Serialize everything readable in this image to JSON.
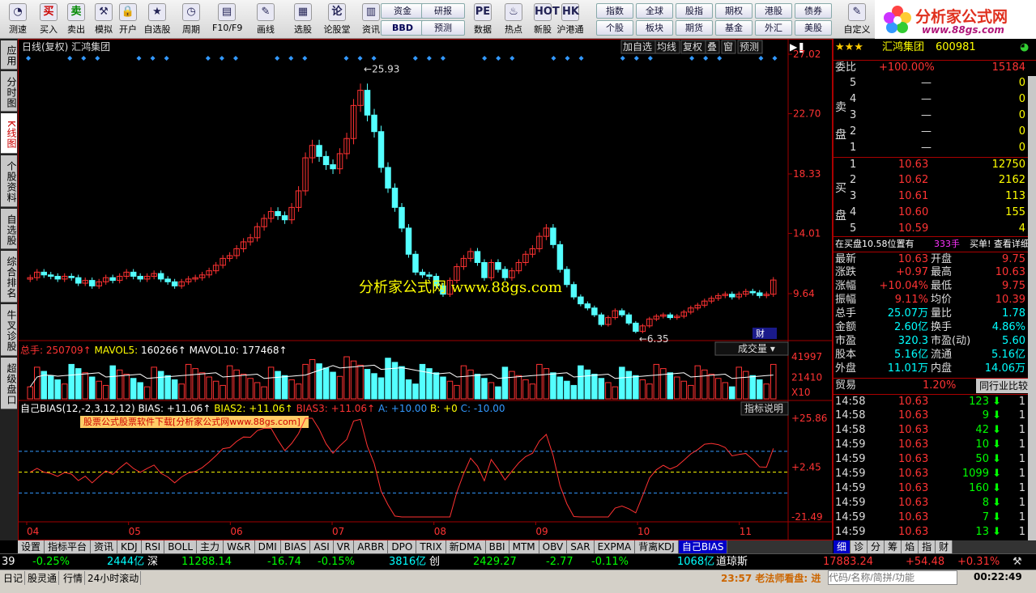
{
  "toolbar": {
    "buttons": [
      {
        "label": "测速",
        "glyph": "◔"
      },
      {
        "label": "买入",
        "glyph": "买"
      },
      {
        "label": "卖出",
        "glyph": "卖"
      },
      {
        "label": "模拟",
        "glyph": "⚒"
      },
      {
        "label": "开户",
        "glyph": "🔒"
      },
      {
        "label": "自选股",
        "glyph": "★"
      },
      {
        "label": "周期",
        "glyph": "◷"
      },
      {
        "label": "F10/F9",
        "glyph": "▤"
      },
      {
        "label": "画线",
        "glyph": "✎"
      },
      {
        "label": "选股",
        "glyph": "▦"
      },
      {
        "label": "论股堂",
        "glyph": "论"
      },
      {
        "label": "资讯",
        "glyph": "▥"
      },
      {
        "label": "数据",
        "glyph": "PE"
      },
      {
        "label": "热点",
        "glyph": "♨"
      },
      {
        "label": "新股",
        "glyph": "HOT"
      },
      {
        "label": "沪港通",
        "glyph": "HK"
      },
      {
        "label": "自定义",
        "glyph": "✎"
      }
    ],
    "tags_a": [
      "资金",
      "研报",
      "BBD",
      "预测"
    ],
    "tags_b": [
      "指数",
      "全球",
      "股指",
      "期权",
      "港股",
      "债券",
      "个股",
      "板块",
      "期货",
      "基金",
      "外汇",
      "美股"
    ]
  },
  "logo": {
    "title": "分析家公式网",
    "url": "www.88gs.com"
  },
  "left_tabs": [
    "应用",
    "分时图",
    "K线图",
    "个股资料",
    "自选股",
    "综合排名",
    "牛叉诊股",
    "超级盘口"
  ],
  "chart": {
    "title": "日线(复权)  汇鸿集团",
    "top_buttons": [
      "加自选",
      "均线",
      "复权",
      "叠",
      "窗",
      "预测"
    ],
    "price_axis": [
      "27.02",
      "22.70",
      "18.33",
      "14.01",
      "9.64"
    ],
    "high_label": "25.93",
    "low_label": "6.35",
    "watermark": "分析家公式网  www.88gs.com",
    "finance_tag": "财",
    "vol_header": {
      "total_label": "总手:",
      "total": "250709",
      "ma5_label": "MAVOL5:",
      "ma5": "160266",
      "ma10_label": "MAVOL10:",
      "ma10": "177468"
    },
    "vol_button": "成交量",
    "vol_axis": [
      "41997",
      "21410",
      "X10"
    ],
    "bias_header": {
      "name": "自己BIAS(12,-2,3,12,12)",
      "b1": "BIAS: +11.06",
      "b2": "BIAS2: +11.06",
      "b3": "BIAS3: +11.06",
      "a": "A: +10.00",
      "b": "B: +0",
      "c": "C: -10.00"
    },
    "bias_button": "指标说明",
    "bias_note": "股票公式股票软件下载[分析家公式网www.88gs.com]",
    "bias_axis": [
      "+25.86",
      "+2.45",
      "-21.49"
    ],
    "months": [
      "04",
      "05",
      "06",
      "07",
      "08",
      "09",
      "10",
      "11"
    ],
    "colors": {
      "up": "#ff3232",
      "down": "#54ffff",
      "ma": "#ffffff",
      "bias": "#ff3232",
      "grid": "#a00000"
    }
  },
  "chart_data": [
    {
      "type": "candlestick",
      "title": "日线(复权)  汇鸿集团",
      "ylim": [
        6.35,
        27.02
      ],
      "high": 25.93,
      "low": 6.35,
      "close": [
        10.8,
        11.2,
        11.0,
        10.9,
        10.7,
        10.9,
        10.8,
        10.4,
        10.6,
        10.2,
        10.5,
        10.8,
        10.6,
        10.9,
        11.2,
        10.9,
        10.7,
        10.9,
        11.1,
        10.7,
        10.5,
        10.2,
        10.5,
        10.7,
        10.8,
        11.0,
        11.3,
        11.7,
        12.2,
        12.4,
        12.9,
        13.4,
        13.7,
        14.5,
        15.1,
        15.6,
        15.3,
        15.0,
        15.9,
        17.1,
        19.5,
        20.4,
        19.6,
        19.0,
        18.7,
        19.8,
        20.9,
        23.3,
        24.4,
        22.6,
        21.4,
        18.8,
        17.3,
        15.9,
        14.4,
        12.5,
        11.2,
        11.0,
        10.9,
        10.2,
        9.6,
        10.6,
        11.6,
        12.2,
        12.7,
        11.9,
        10.8,
        11.9,
        11.4,
        10.8,
        11.3,
        11.9,
        12.5,
        12.9,
        13.8,
        14.4,
        13.2,
        11.4,
        10.3,
        9.4,
        8.9,
        8.6,
        8.1,
        7.4,
        7.9,
        8.4,
        8.1,
        7.5,
        6.9,
        7.3,
        7.8,
        8.0,
        8.1,
        7.9,
        8.0,
        8.3,
        8.6,
        8.8,
        9.1,
        9.3,
        9.5,
        9.6,
        9.4,
        9.6,
        9.8,
        9.7,
        9.5,
        9.6,
        10.63
      ]
    },
    {
      "type": "bar",
      "title": "成交量",
      "series": [
        {
          "name": "总手",
          "values": []
        },
        {
          "name": "MAVOL5",
          "values": []
        },
        {
          "name": "MAVOL10",
          "values": []
        }
      ],
      "last": {
        "total": 250709,
        "mavol5": 160266,
        "mavol10": 177468
      },
      "ylim": [
        0,
        41997
      ]
    },
    {
      "type": "line",
      "title": "自己BIAS(12,-2,3,12,12)",
      "ylim": [
        -21.49,
        25.86
      ],
      "reference_lines": [
        {
          "name": "A",
          "value": 10
        },
        {
          "name": "B",
          "value": 0
        },
        {
          "name": "C",
          "value": -10
        }
      ],
      "series": [
        {
          "name": "BIAS",
          "last": 11.06
        }
      ]
    }
  ],
  "quote": {
    "name": "汇鸿集团",
    "code": "600981",
    "weibi": {
      "label": "委比",
      "value": "+100.00%",
      "num": "15184"
    },
    "sell": [
      {
        "lv": "5",
        "p": "—",
        "v": "0"
      },
      {
        "lv": "4",
        "p": "—",
        "v": "0"
      },
      {
        "lv": "3",
        "p": "—",
        "v": "0"
      },
      {
        "lv": "2",
        "p": "—",
        "v": "0"
      },
      {
        "lv": "1",
        "p": "—",
        "v": "0"
      }
    ],
    "buy": [
      {
        "lv": "1",
        "p": "10.63",
        "v": "12750"
      },
      {
        "lv": "2",
        "p": "10.62",
        "v": "2162"
      },
      {
        "lv": "3",
        "p": "10.61",
        "v": "113"
      },
      {
        "lv": "4",
        "p": "10.60",
        "v": "155"
      },
      {
        "lv": "5",
        "p": "10.59",
        "v": "4"
      }
    ],
    "sell_label": "卖盘",
    "buy_label": "买盘",
    "info_bar": {
      "text": "在买盘10.58位置有",
      "amt": "333手",
      "tail": "买单! 查看详细"
    },
    "stats": [
      [
        "最新",
        "10.63",
        "开盘",
        "9.75"
      ],
      [
        "涨跌",
        "+0.97",
        "最高",
        "10.63"
      ],
      [
        "涨幅",
        "+10.04%",
        "最低",
        "9.75"
      ],
      [
        "振幅",
        "9.11%",
        "均价",
        "10.39"
      ],
      [
        "总手",
        "25.07万",
        "量比",
        "1.78"
      ],
      [
        "金额",
        "2.60亿",
        "换手",
        "4.86%"
      ],
      [
        "市盈",
        "320.3",
        "市盈(动)",
        "5.60"
      ],
      [
        "股本",
        "5.16亿",
        "流通",
        "5.16亿"
      ],
      [
        "外盘",
        "11.01万",
        "内盘",
        "14.06万"
      ]
    ],
    "industry": {
      "label": "贸易",
      "value": "1.20%",
      "button": "同行业比较"
    },
    "ticks": [
      [
        "14:58",
        "10.63",
        "123"
      ],
      [
        "14:58",
        "10.63",
        "9"
      ],
      [
        "14:58",
        "10.63",
        "42"
      ],
      [
        "14:59",
        "10.63",
        "10"
      ],
      [
        "14:59",
        "10.63",
        "50"
      ],
      [
        "14:59",
        "10.63",
        "1099"
      ],
      [
        "14:59",
        "10.63",
        "160"
      ],
      [
        "14:59",
        "10.63",
        "8"
      ],
      [
        "14:59",
        "10.63",
        "7"
      ],
      [
        "14:59",
        "10.63",
        "13"
      ]
    ],
    "tick_flag": "1",
    "right_tabs": [
      "细",
      "诊",
      "分",
      "筹",
      "焰",
      "指",
      "财"
    ]
  },
  "bottom_tabs": [
    "设置",
    "指标平台",
    "资讯",
    "KDJ",
    "RSI",
    "BOLL",
    "主力",
    "W&R",
    "DMI",
    "BIAS",
    "ASI",
    "VR",
    "ARBR",
    "DPO",
    "TRIX",
    "新DMA",
    "BBI",
    "MTM",
    "OBV",
    "SAR",
    "EXPMA",
    "背离KDJ",
    "自己BIAS"
  ],
  "ticker": [
    {
      "t": "39",
      "c": "white"
    },
    {
      "t": "-0.25%",
      "c": "green"
    },
    {
      "t": "2444亿",
      "c": "cyan"
    },
    {
      "t": "深",
      "c": "white"
    },
    {
      "t": "11288.14",
      "c": "green"
    },
    {
      "t": "-16.74",
      "c": "green"
    },
    {
      "t": "-0.15%",
      "c": "green"
    },
    {
      "t": "3816亿",
      "c": "cyan"
    },
    {
      "t": "创",
      "c": "white"
    },
    {
      "t": "2429.27",
      "c": "green"
    },
    {
      "t": "-2.77",
      "c": "green"
    },
    {
      "t": "-0.11%",
      "c": "green"
    },
    {
      "t": "1068亿",
      "c": "cyan"
    },
    {
      "t": "道琼斯",
      "c": "white"
    },
    {
      "t": "17883.24",
      "c": "red"
    },
    {
      "t": "+54.48",
      "c": "red"
    },
    {
      "t": "+0.31%",
      "c": "red"
    }
  ],
  "status": {
    "items": [
      "日记",
      "股灵通",
      "行情",
      "24小时滚动"
    ],
    "news": "23:57 老法师看盘: 进",
    "search_placeholder": "代码/名称/简拼/功能",
    "clock": "00:22:49"
  }
}
